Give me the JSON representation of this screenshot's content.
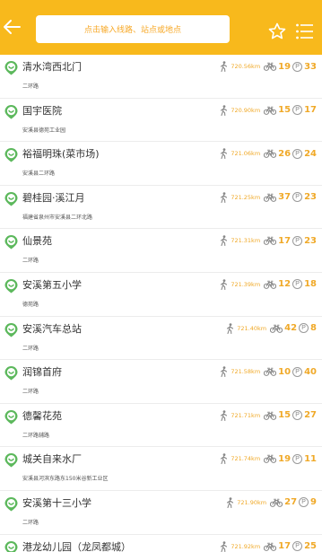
{
  "header": {
    "search_placeholder": "点击输入线路、站点或地点"
  },
  "stations": [
    {
      "name": "清水湾西北门",
      "address": "二环路",
      "distance": "720.56km",
      "bikes": "19",
      "docks": "33"
    },
    {
      "name": "国宇医院",
      "address": "安溪县德苑工业园",
      "distance": "720.90km",
      "bikes": "15",
      "docks": "17"
    },
    {
      "name": "裕福明珠(菜市场)",
      "address": "安溪县二环路",
      "distance": "721.06km",
      "bikes": "26",
      "docks": "24"
    },
    {
      "name": "碧桂园·溪江月",
      "address": "福建省泉州市安溪县二环北路",
      "distance": "721.25km",
      "bikes": "37",
      "docks": "23"
    },
    {
      "name": "仙景苑",
      "address": "二环路",
      "distance": "721.31km",
      "bikes": "17",
      "docks": "23"
    },
    {
      "name": "安溪第五小学",
      "address": "德苑路",
      "distance": "721.39km",
      "bikes": "12",
      "docks": "18"
    },
    {
      "name": "安溪汽车总站",
      "address": "二环路",
      "distance": "721.40km",
      "bikes": "42",
      "docks": "8"
    },
    {
      "name": "润锦首府",
      "address": "二环路",
      "distance": "721.58km",
      "bikes": "10",
      "docks": "40"
    },
    {
      "name": "德馨花苑",
      "address": "二环路辅路",
      "distance": "721.71km",
      "bikes": "15",
      "docks": "27"
    },
    {
      "name": "城关自来水厂",
      "address": "安溪县河滨东路东150米谷新工业区",
      "distance": "721.74km",
      "bikes": "19",
      "docks": "11"
    },
    {
      "name": "安溪第十三小学",
      "address": "二环路",
      "distance": "721.90km",
      "bikes": "27",
      "docks": "9"
    },
    {
      "name": "港龙幼儿园（龙凤都城）",
      "address": "",
      "distance": "721.92km",
      "bikes": "17",
      "docks": "25"
    }
  ],
  "icons": {
    "back": "arrow-left-icon",
    "favorite": "star-outline-icon",
    "menu": "list-menu-icon",
    "station": "map-pin-smile-icon",
    "walk": "walking-person-icon",
    "bike": "bicycle-icon",
    "parking": "parking-p-icon"
  },
  "colors": {
    "header_bg": "#f8b91c",
    "accent": "#f0a928",
    "pin_green": "#5cb85c"
  }
}
